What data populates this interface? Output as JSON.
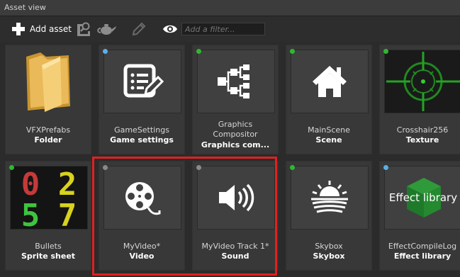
{
  "window": {
    "title": "Asset view"
  },
  "toolbar": {
    "add_asset_label": "Add asset",
    "filter_placeholder": "Add a filter..."
  },
  "assets": [
    {
      "name": "VFXPrefabs",
      "type": "Folder",
      "status": "none",
      "icon": "folder-icon"
    },
    {
      "name": "GameSettings",
      "type": "Game settings",
      "status": "blue",
      "icon": "settings-form-icon"
    },
    {
      "name": "Graphics",
      "name2": "Compositor",
      "type": "Graphics com...",
      "status": "green",
      "icon": "graph-nodes-icon"
    },
    {
      "name": "MainScene",
      "type": "Scene",
      "status": "green",
      "icon": "house-icon"
    },
    {
      "name": "Crosshair256",
      "type": "Texture",
      "status": "green",
      "icon": "crosshair-icon"
    },
    {
      "name": "Bullets",
      "type": "Sprite sheet",
      "status": "green",
      "icon": "digits-sprite-icon",
      "digits": [
        "0",
        "2",
        "5",
        "7"
      ]
    },
    {
      "name": "MyVideo*",
      "type": "Video",
      "status": "gray",
      "icon": "film-reel-icon"
    },
    {
      "name": "MyVideo Track 1*",
      "type": "Sound",
      "status": "gray",
      "icon": "speaker-icon"
    },
    {
      "name": "Skybox",
      "type": "Skybox",
      "status": "green",
      "icon": "sunrise-icon"
    },
    {
      "name": "EffectCompileLog",
      "type": "Effect library",
      "status": "blue",
      "icon": "cube-icon",
      "thumb_text": "Effect library"
    }
  ],
  "colors": {
    "highlight": "#e0201f",
    "status_green": "#2fb82f",
    "status_blue": "#5ab0e6",
    "status_gray": "#8a8a8a"
  }
}
